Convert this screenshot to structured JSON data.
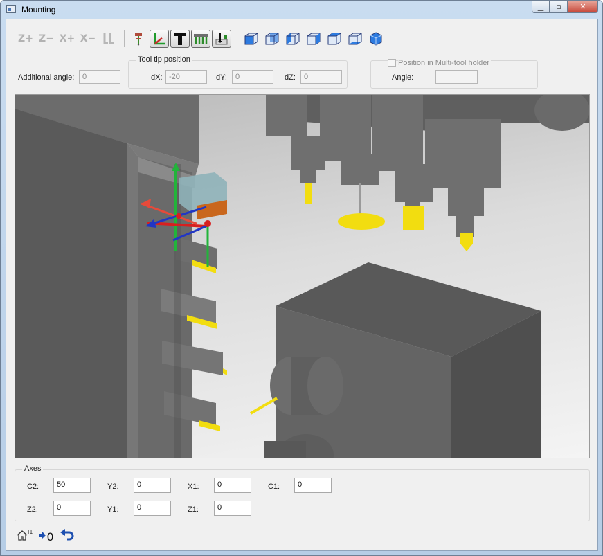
{
  "window": {
    "title": "Mounting",
    "colors": {
      "accent": "#1d4fb0",
      "tool_yellow": "#f2dd10",
      "close_red": "#c7483a"
    }
  },
  "toolbar": {
    "buttons": [
      {
        "label": "Z+",
        "icon": "z-plus-icon",
        "enabled": false
      },
      {
        "label": "Z−",
        "icon": "z-minus-icon",
        "enabled": false
      },
      {
        "label": "X+",
        "icon": "x-plus-icon",
        "enabled": false
      },
      {
        "label": "X−",
        "icon": "x-minus-icon",
        "enabled": false
      },
      {
        "label": "",
        "icon": "mirror-tool-icon",
        "enabled": false
      }
    ],
    "tools": [
      "tool-tip-marker-icon",
      "coordinate-axes-icon",
      "text-t-icon",
      "multi-tool-holder-icon",
      "measure-tool-icon"
    ],
    "views": [
      "view-front-icon",
      "view-back-icon",
      "view-left-icon",
      "view-right-icon",
      "view-top-icon",
      "view-bottom-icon",
      "view-iso-icon"
    ]
  },
  "params": {
    "additional_angle_label": "Additional  angle:",
    "additional_angle_value": "0",
    "tool_tip_title": "Tool tip position",
    "dx_label": "dX:",
    "dx_value": "-20",
    "dy_label": "dY:",
    "dy_value": "0",
    "dz_label": "dZ:",
    "dz_value": "0",
    "multi_tool_label": "Position in Multi-tool holder",
    "multi_tool_checked": false,
    "angle_label": "Angle:",
    "angle_value": ""
  },
  "axes": {
    "title": "Axes",
    "c2_label": "C2:",
    "c2_value": "50",
    "y2_label": "Y2:",
    "y2_value": "0",
    "x1_label": "X1:",
    "x1_value": "0",
    "c1_label": "C1:",
    "c1_value": "0",
    "z2_label": "Z2:",
    "z2_value": "0",
    "y1_label": "Y1:",
    "y1_value": "0",
    "z1_label": "Z1:",
    "z1_value": "0"
  },
  "bottom": {
    "home_badge": "I1",
    "goto_zero_label": "0",
    "icons": [
      "home-icon",
      "go-to-zero-icon",
      "undo-icon"
    ]
  }
}
